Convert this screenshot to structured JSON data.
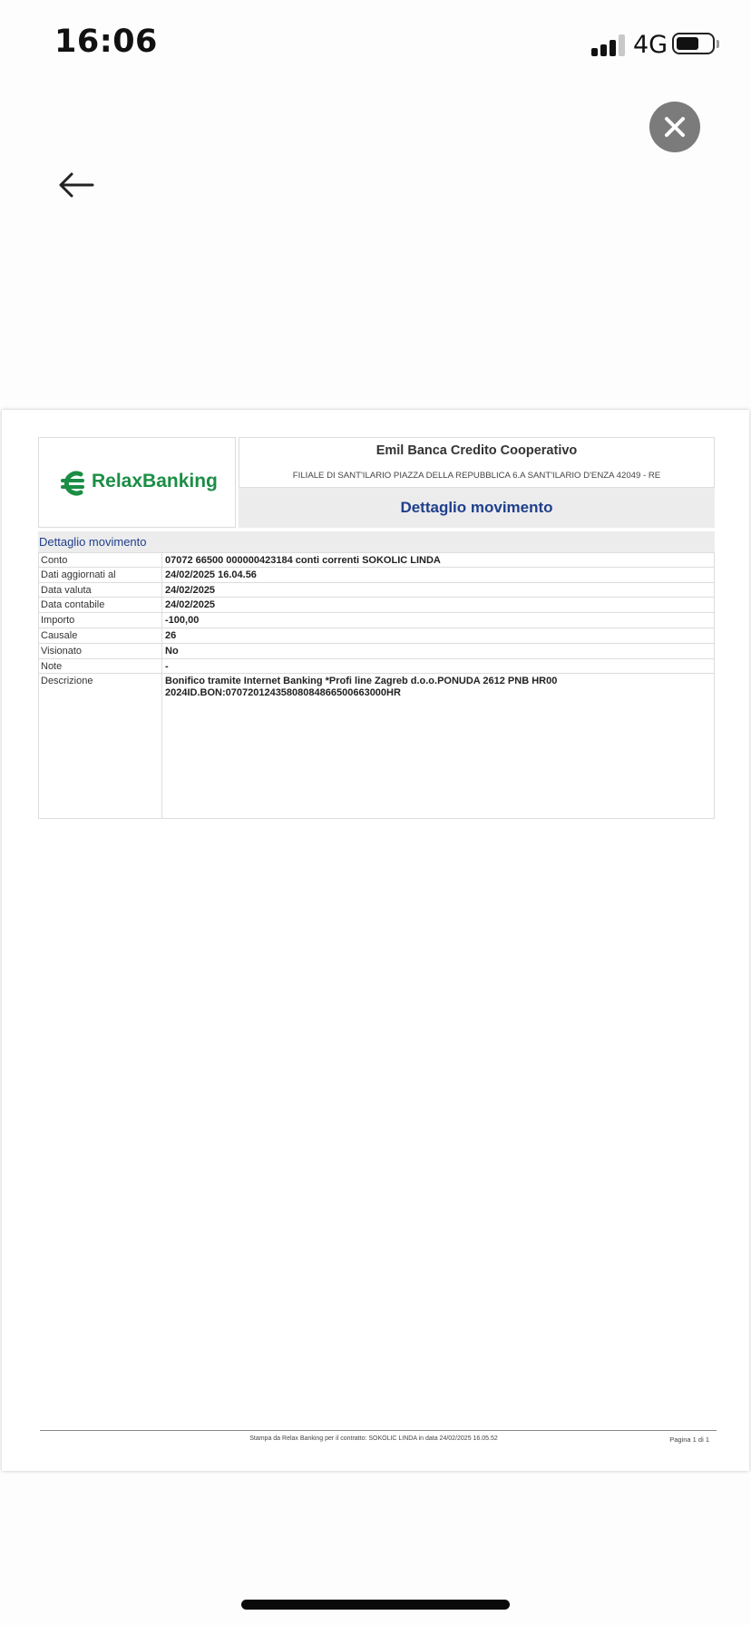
{
  "status_bar": {
    "time": "16:06",
    "network": "4G",
    "battery_level": 0.6,
    "signal_bars_active": 3,
    "signal_bars_total": 4
  },
  "nav": {
    "close_icon": "close-icon",
    "back_icon": "arrow-left-icon"
  },
  "document": {
    "logo_text": "RelaxBanking",
    "logo_color": "#1b8e45",
    "bank_name": "Emil Banca Credito Cooperativo",
    "bank_address": "FILIALE DI SANT'ILARIO PIAZZA DELLA REPUBBLICA 6.A SANT'ILARIO D'ENZA 42049 - RE",
    "title": "Dettaglio movimento",
    "title_color": "#1f3f8c",
    "section_title": "Dettaglio movimento",
    "rows": [
      {
        "label": "Conto",
        "value": "07072 66500 000000423184 conti correnti SOKOLIC LINDA"
      },
      {
        "label": "Dati aggiornati al",
        "value": "24/02/2025 16.04.56"
      },
      {
        "label": "Data valuta",
        "value": "24/02/2025"
      },
      {
        "label": "Data contabile",
        "value": "24/02/2025"
      },
      {
        "label": "Importo",
        "value": "-100,00"
      },
      {
        "label": "Causale",
        "value": "26"
      },
      {
        "label": "Visionato",
        "value": "No"
      },
      {
        "label": "Note",
        "value": "-"
      }
    ],
    "description": {
      "label": "Descrizione",
      "line1": "Bonifico tramite Internet Banking *Profi line Zagreb d.o.o.PONUDA 2612 PNB HR00",
      "line2": "2024ID.BON:07072012435808084866500663000HR"
    },
    "footer_text": "Stampa da Relax Banking per il contratto: SOKOLIC LINDA in data 24/02/2025 16.05.52",
    "page_label": "Pagina 1 di  1"
  }
}
